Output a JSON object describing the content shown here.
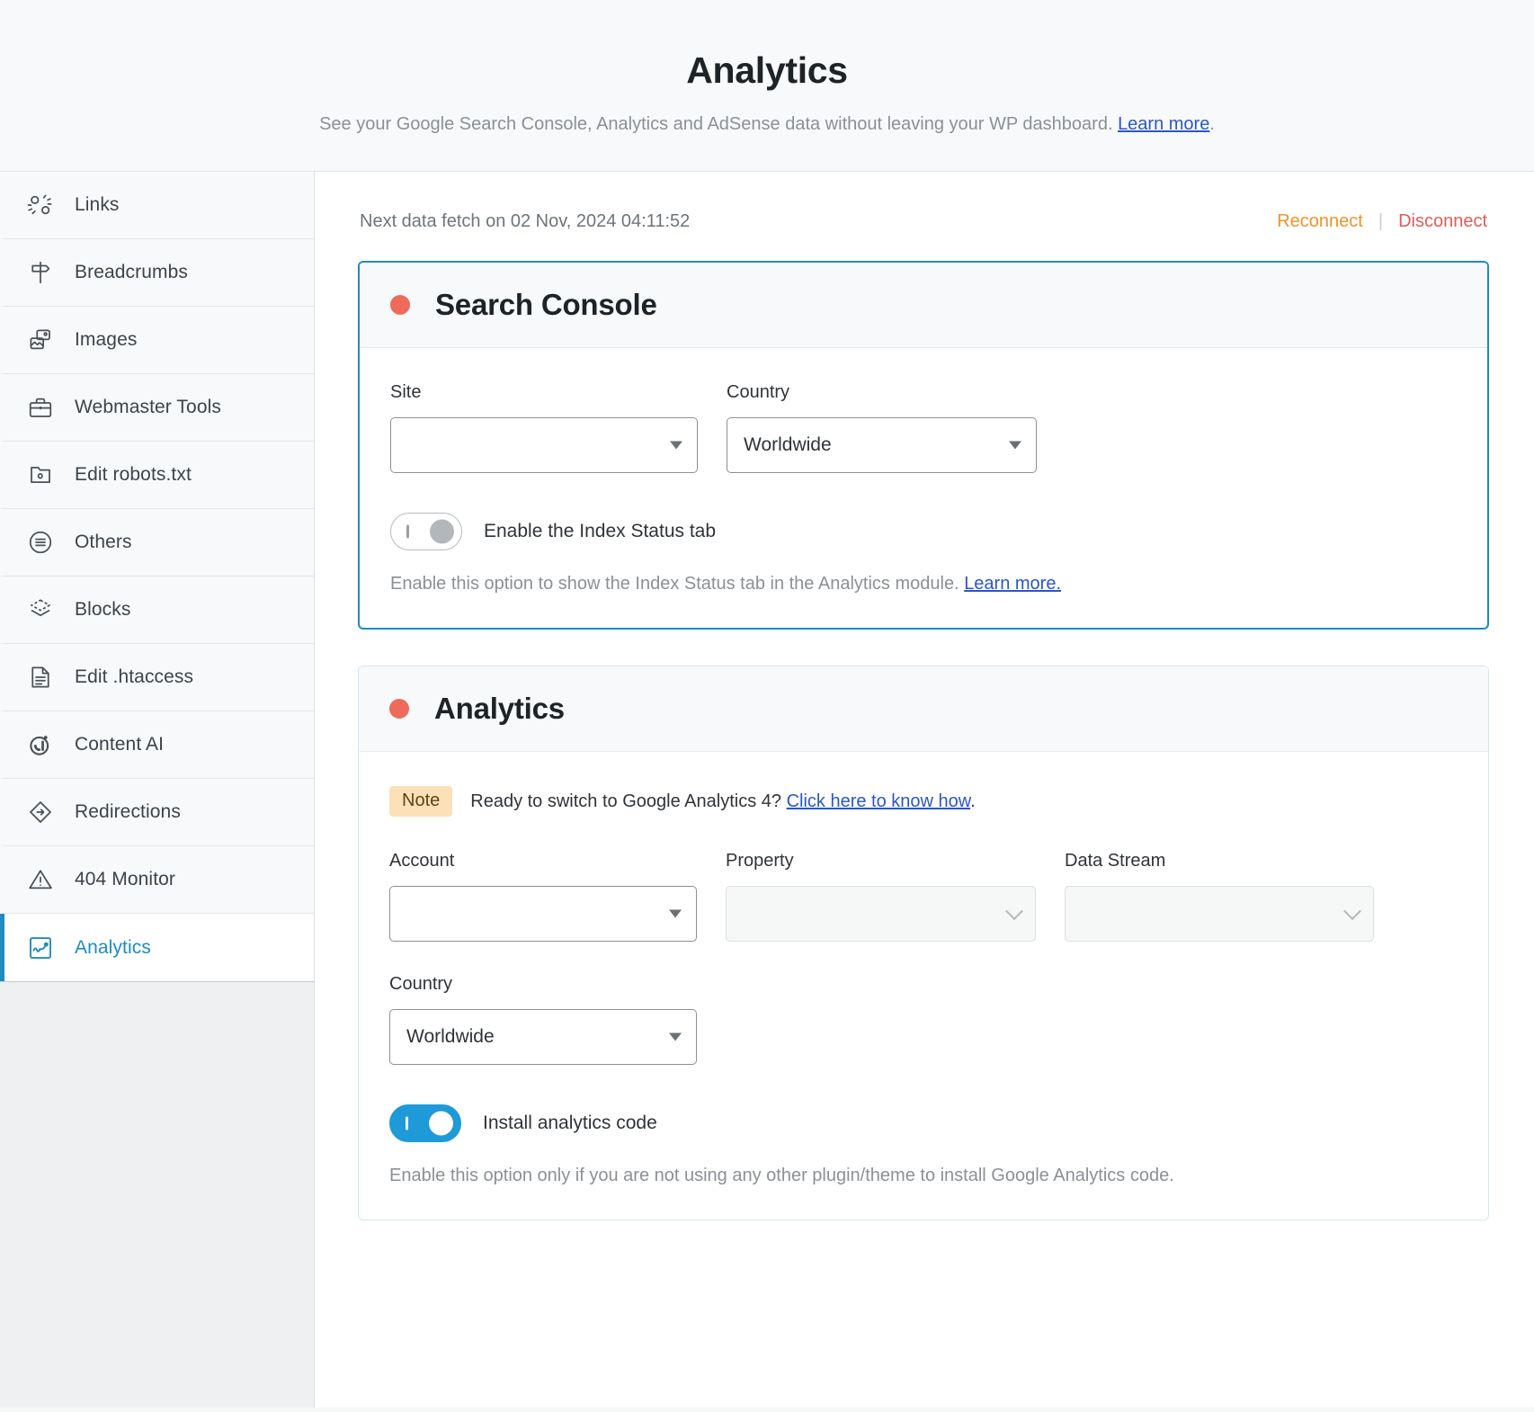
{
  "header": {
    "title": "Analytics",
    "subtitle_before": "See your Google Search Console, Analytics and AdSense data without leaving your WP dashboard. ",
    "subtitle_link": "Learn more",
    "subtitle_after": "."
  },
  "sidebar": {
    "items": [
      {
        "label": "Links",
        "icon": "links-icon",
        "active": false
      },
      {
        "label": "Breadcrumbs",
        "icon": "signpost-icon",
        "active": false
      },
      {
        "label": "Images",
        "icon": "images-icon",
        "active": false
      },
      {
        "label": "Webmaster Tools",
        "icon": "toolbox-icon",
        "active": false
      },
      {
        "label": "Edit robots.txt",
        "icon": "folder-robot-icon",
        "active": false
      },
      {
        "label": "Others",
        "icon": "list-circle-icon",
        "active": false
      },
      {
        "label": "Blocks",
        "icon": "layers-icon",
        "active": false
      },
      {
        "label": "Edit .htaccess",
        "icon": "file-lines-icon",
        "active": false
      },
      {
        "label": "Content AI",
        "icon": "content-ai-icon",
        "active": false
      },
      {
        "label": "Redirections",
        "icon": "redirect-arrow-icon",
        "active": false
      },
      {
        "label": "404 Monitor",
        "icon": "warning-triangle-icon",
        "active": false
      },
      {
        "label": "Analytics",
        "icon": "chart-line-icon",
        "active": true
      }
    ]
  },
  "toolbar": {
    "fetch_text": "Next data fetch on 02 Nov, 2024 04:11:52",
    "reconnect_label": "Reconnect",
    "separator": "|",
    "disconnect_label": "Disconnect"
  },
  "search_console": {
    "title": "Search Console",
    "status_color": "#ef6a5a",
    "site": {
      "label": "Site",
      "value": "",
      "placeholder": ""
    },
    "country": {
      "label": "Country",
      "value": "Worldwide"
    },
    "index_status": {
      "toggle_label": "Enable the Index Status tab",
      "enabled": false,
      "help_before": "Enable this option to show the Index Status tab in the Analytics module. ",
      "help_link": "Learn more.",
      "help_after": ""
    }
  },
  "analytics": {
    "title": "Analytics",
    "status_color": "#ef6a5a",
    "note": {
      "badge": "Note",
      "text_before": "Ready to switch to Google Analytics 4? ",
      "link": "Click here to know how",
      "text_after": "."
    },
    "account": {
      "label": "Account",
      "value": "",
      "disabled": false
    },
    "property": {
      "label": "Property",
      "value": "",
      "disabled": true
    },
    "data_stream": {
      "label": "Data Stream",
      "value": "",
      "disabled": true
    },
    "country": {
      "label": "Country",
      "value": "Worldwide",
      "disabled": false
    },
    "install_code": {
      "toggle_label": "Install analytics code",
      "enabled": true,
      "help": "Enable this option only if you are not using any other plugin/theme to install Google Analytics code."
    }
  },
  "colors": {
    "accent_blue": "#1e8cbe",
    "toggle_on": "#1e9ad8",
    "reconnect": "#f0932b",
    "disconnect": "#e05c5c",
    "link": "#2a56c6",
    "note_bg": "#fbe0b8"
  }
}
